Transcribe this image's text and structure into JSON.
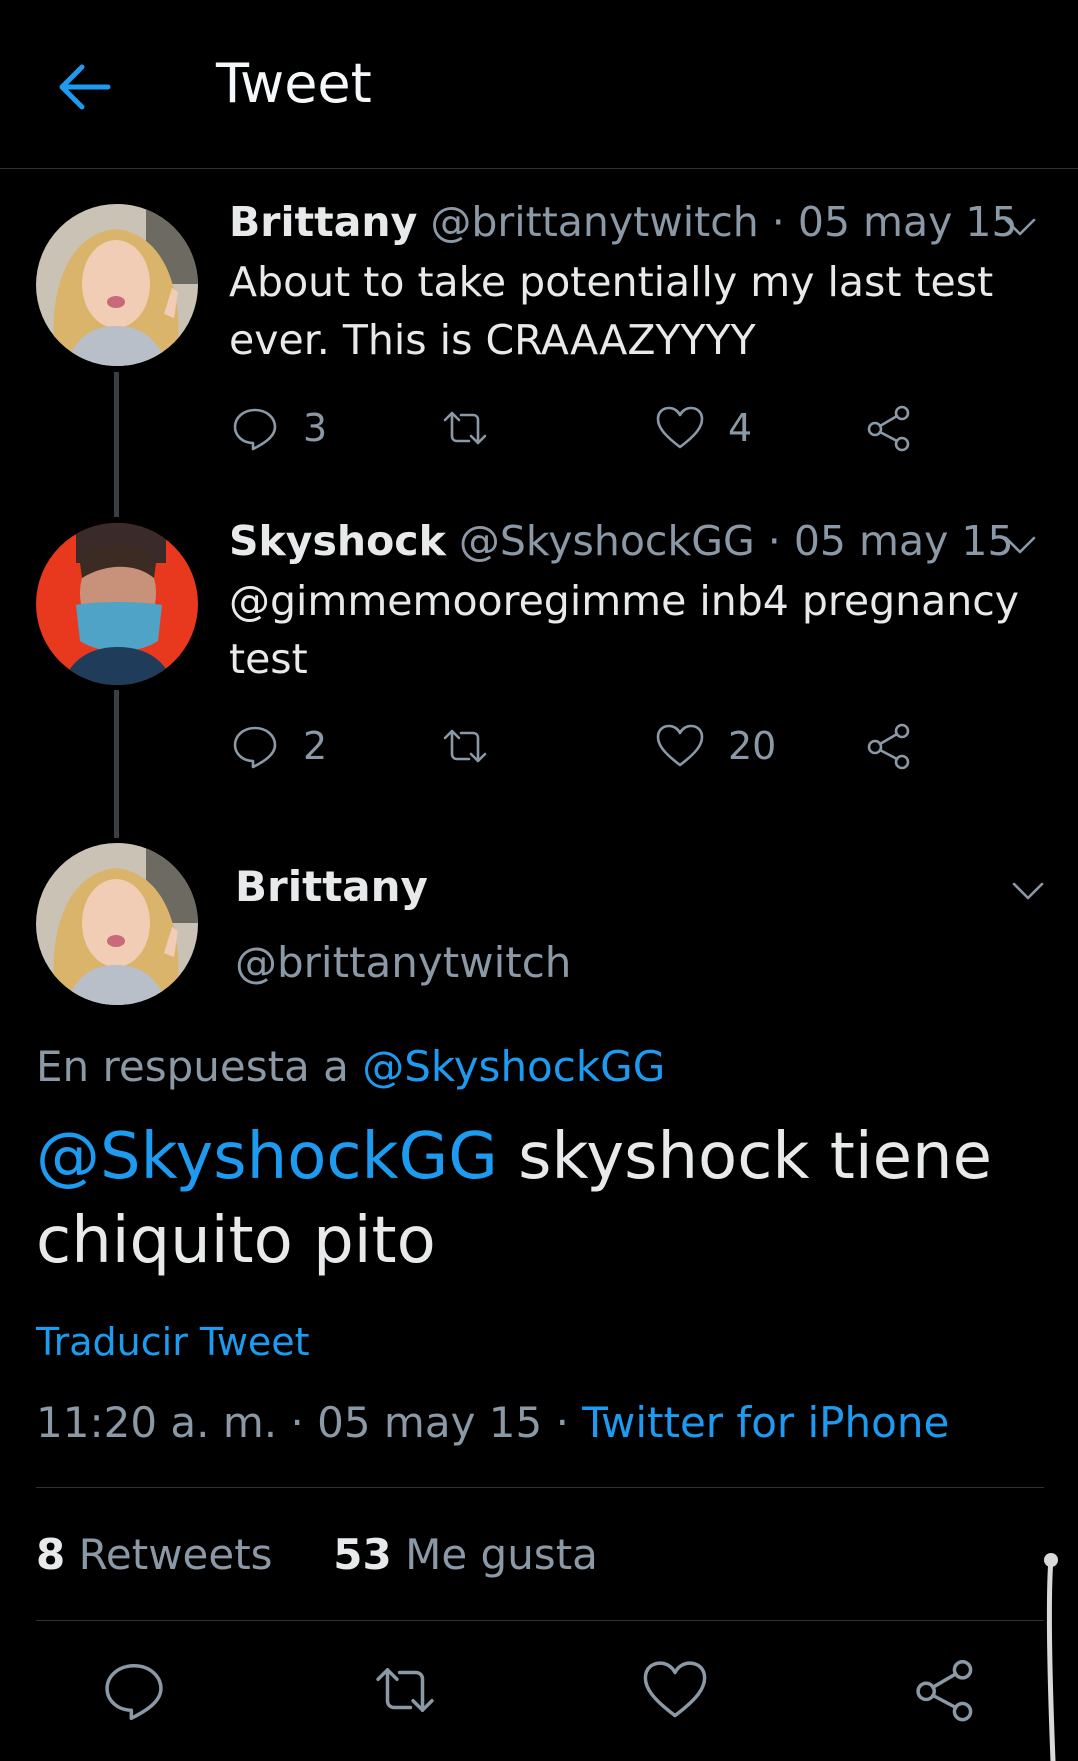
{
  "header": {
    "title": "Tweet"
  },
  "thread": [
    {
      "name": "Brittany",
      "meta": "@brittanytwitch · 05 may 15",
      "text": "About to take potentially my last test ever. This is CRAAAZYYYY",
      "replies": "3",
      "retweets": "",
      "likes": "4"
    },
    {
      "name": "Skyshock",
      "meta": "@SkyshockGG · 05 may 15",
      "text": "@gimmemooregimme inb4 pregnancy test",
      "replies": "2",
      "retweets": "",
      "likes": "20"
    }
  ],
  "main": {
    "name": "Brittany",
    "handle": "@brittanytwitch",
    "reply_prefix": "En respuesta a ",
    "reply_to": "@SkyshockGG",
    "text_mention": "@SkyshockGG",
    "text_body": " skyshock tiene chiquito pito",
    "translate": "Traducir Tweet",
    "timestamp": "11:20 a. m. · 05 may 15 · ",
    "source": "Twitter for iPhone",
    "retweets_count": "8",
    "retweets_label": " Retweets",
    "likes_count": "53",
    "likes_label": " Me gusta"
  },
  "colors": {
    "accent": "#1d9bf0",
    "background": "#000000",
    "muted": "#8b98a5"
  }
}
